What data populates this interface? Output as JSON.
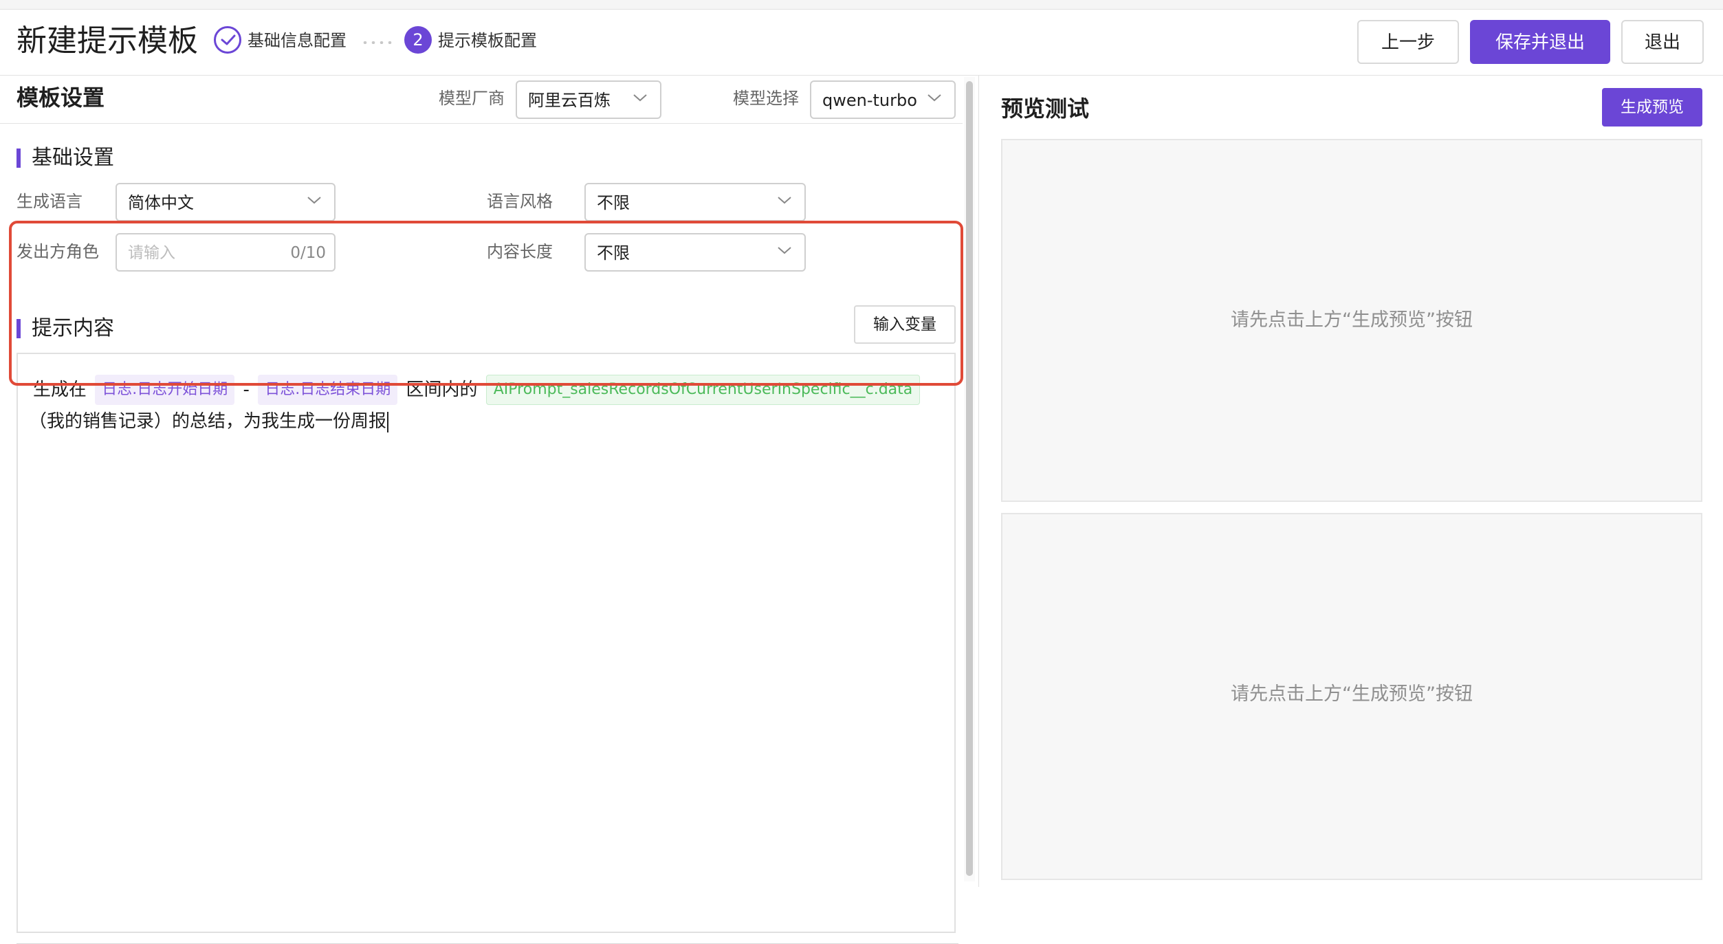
{
  "header": {
    "title": "新建提示模板",
    "steps": [
      {
        "label": "基础信息配置",
        "status": "done"
      },
      {
        "number": "2",
        "label": "提示模板配置",
        "status": "active"
      }
    ],
    "buttons": {
      "prev": "上一步",
      "save_exit": "保存并退出",
      "exit": "退出"
    }
  },
  "template_settings": {
    "title": "模板设置",
    "vendor_label": "模型厂商",
    "vendor_value": "阿里云百炼",
    "model_label": "模型选择",
    "model_value": "qwen-turbo"
  },
  "basic_settings": {
    "title": "基础设置",
    "language_label": "生成语言",
    "language_value": "简体中文",
    "style_label": "语言风格",
    "style_value": "不限",
    "role_label": "发出方角色",
    "role_placeholder": "请输入",
    "role_count": "0/10",
    "length_label": "内容长度",
    "length_value": "不限"
  },
  "prompt_content": {
    "title": "提示内容",
    "insert_variable_button": "输入变量",
    "line1": {
      "text_before": "生成在",
      "var1": "日志.日志开始日期",
      "dash": "-",
      "var2": "日志.日志结束日期",
      "text_mid": "区间内的",
      "var3": "AIPrompt_salesRecordsOfCurrentUserInSpecific__c.data"
    },
    "line2": "（我的销售记录）的总结，为我生成一份周报"
  },
  "preview": {
    "title": "预览测试",
    "generate_button": "生成预览",
    "hint_top": "请先点击上方“生成预览”按钮",
    "hint_bottom": "请先点击上方“生成预览”按钮"
  },
  "colors": {
    "accent": "#6b46d6",
    "highlight_border": "#e04a38",
    "variable_purple_bg": "#f2edfb",
    "variable_green_bg": "#edf9ee"
  }
}
